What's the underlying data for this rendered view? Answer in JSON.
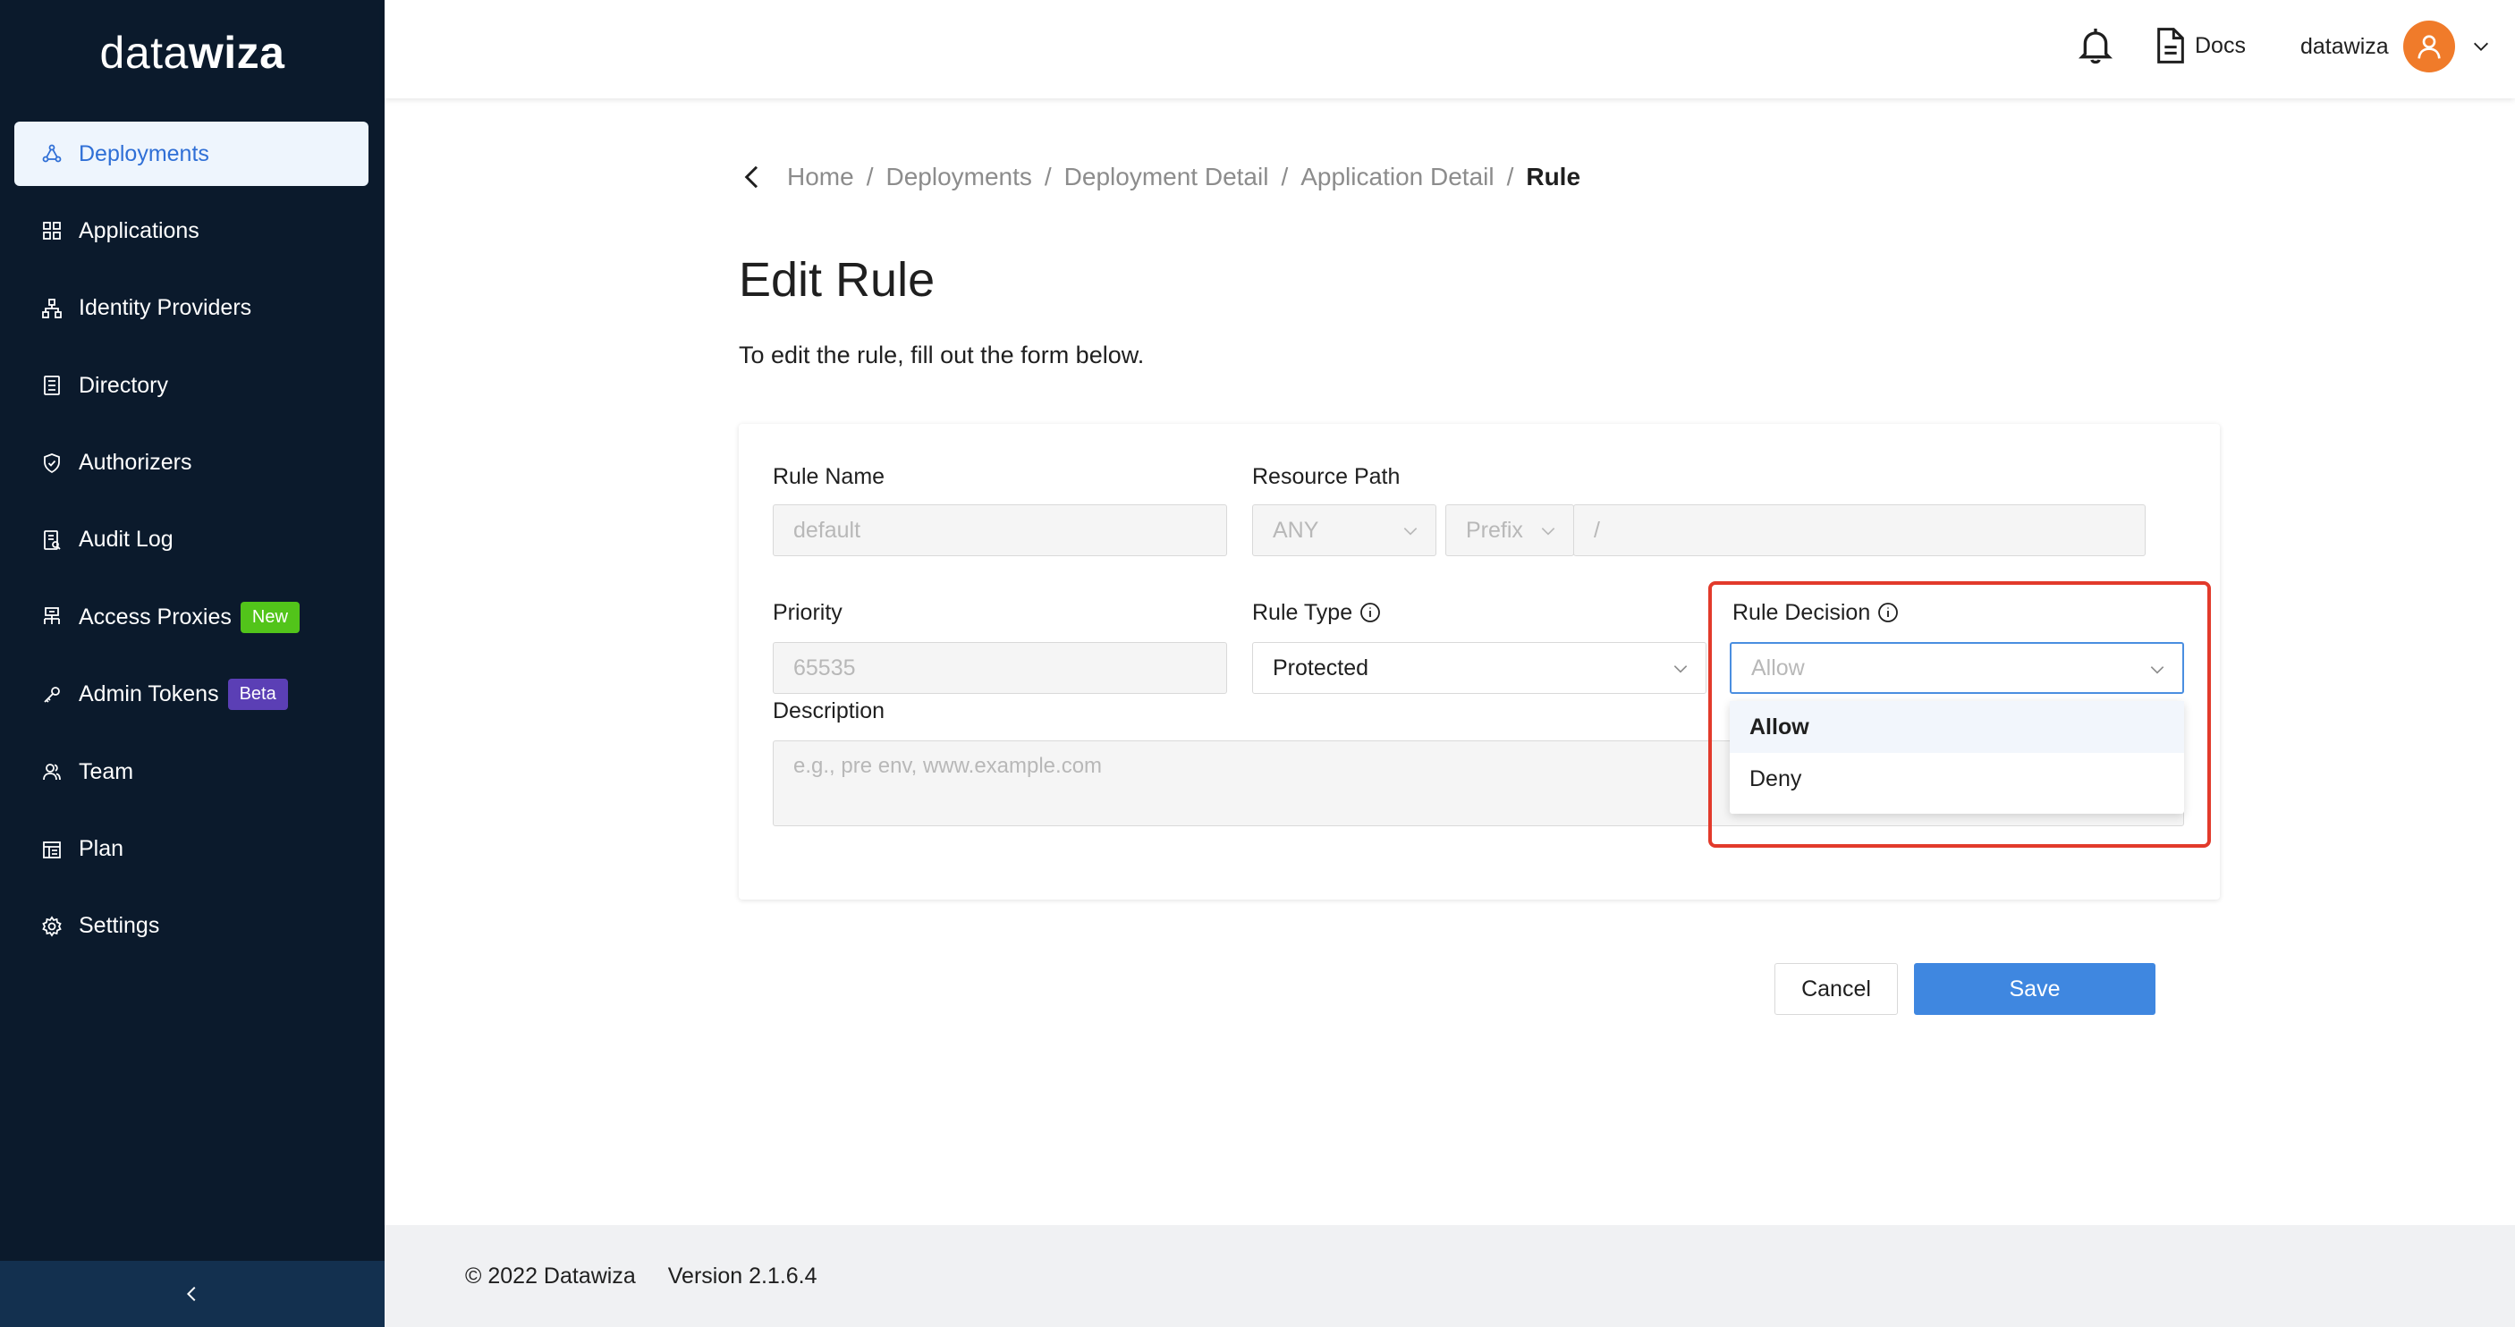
{
  "brand": {
    "logo_light": "data",
    "logo_bold": "wiza"
  },
  "sidebar": {
    "items": [
      {
        "label": "Deployments",
        "icon": "deployments-icon",
        "active": true
      },
      {
        "label": "Applications",
        "icon": "grid-icon"
      },
      {
        "label": "Identity Providers",
        "icon": "hierarchy-icon"
      },
      {
        "label": "Directory",
        "icon": "directory-icon"
      },
      {
        "label": "Authorizers",
        "icon": "shield-icon"
      },
      {
        "label": "Audit Log",
        "icon": "log-icon"
      },
      {
        "label": "Access Proxies",
        "icon": "proxy-icon",
        "badge": "New"
      },
      {
        "label": "Admin Tokens",
        "icon": "token-icon",
        "badge": "Beta"
      },
      {
        "label": "Team",
        "icon": "team-icon"
      },
      {
        "label": "Plan",
        "icon": "plan-icon"
      },
      {
        "label": "Settings",
        "icon": "gear-icon"
      }
    ],
    "collapse_icon": "chevron-left-icon"
  },
  "header": {
    "docs_label": "Docs",
    "username": "datawiza"
  },
  "breadcrumb": {
    "items": [
      "Home",
      "Deployments",
      "Deployment Detail",
      "Application Detail"
    ],
    "current": "Rule",
    "separator": "/"
  },
  "page": {
    "title": "Edit Rule",
    "subtitle": "To edit the rule, fill out the form below."
  },
  "form": {
    "rule_name": {
      "label": "Rule Name",
      "value": "default"
    },
    "resource_path": {
      "label": "Resource Path",
      "method": "ANY",
      "match": "Prefix",
      "path": "/"
    },
    "priority": {
      "label": "Priority",
      "value": "65535"
    },
    "rule_type": {
      "label": "Rule Type",
      "value": "Protected"
    },
    "rule_decision": {
      "label": "Rule Decision",
      "placeholder": "Allow",
      "options": [
        "Allow",
        "Deny"
      ],
      "highlighted": "Allow"
    },
    "description": {
      "label": "Description",
      "placeholder": "e.g., pre env, www.example.com"
    }
  },
  "actions": {
    "cancel": "Cancel",
    "save": "Save"
  },
  "footer": {
    "copyright": "© 2022 Datawiza",
    "version": "Version 2.1.6.4"
  },
  "colors": {
    "sidebar_bg": "#0b1a2c",
    "accent": "#3f87e0",
    "highlight": "#e23a2b",
    "avatar": "#f07b2a",
    "badge_new": "#52c41a",
    "badge_beta": "#5b3fb5"
  }
}
